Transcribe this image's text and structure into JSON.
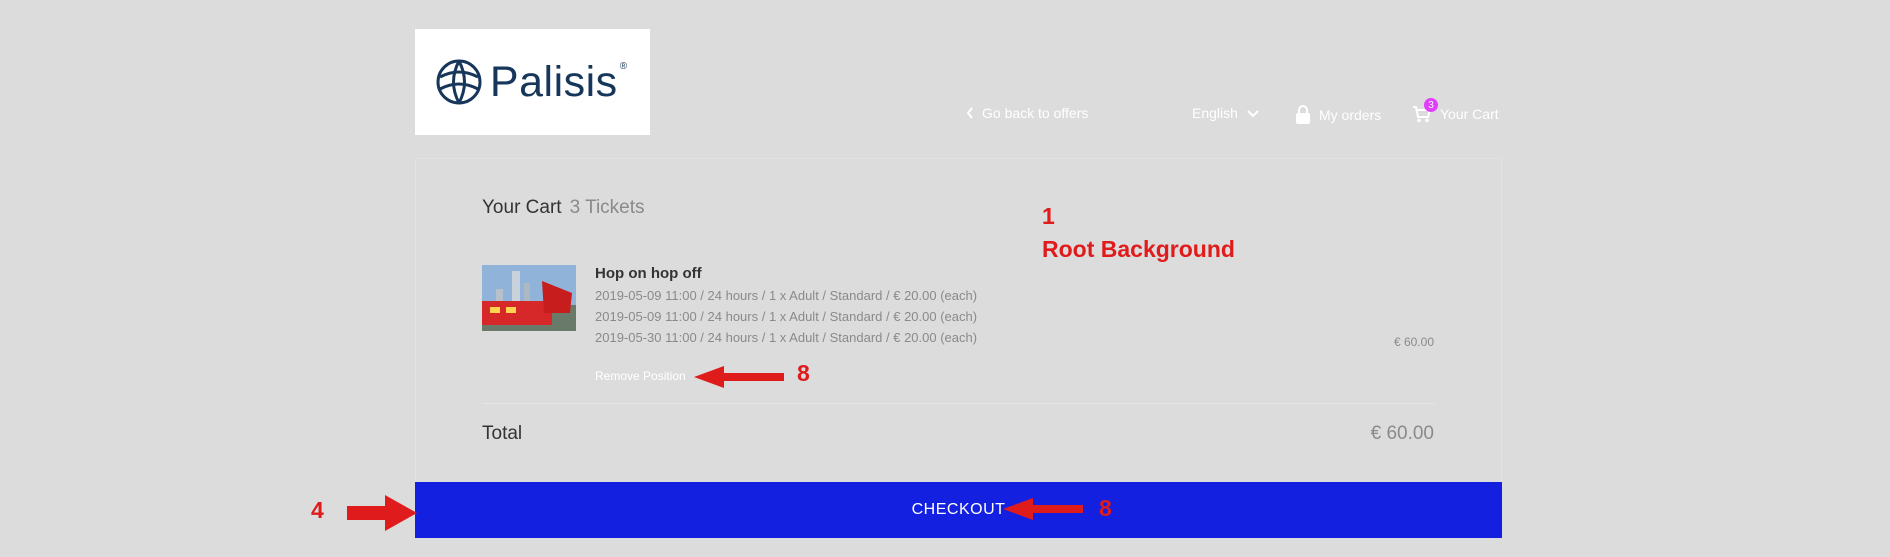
{
  "logo": {
    "text": "Palisis",
    "reg": "®"
  },
  "nav": {
    "back": "Go back to offers",
    "language": "English",
    "orders": "My orders",
    "cart": "Your Cart",
    "cart_badge": "3"
  },
  "cart": {
    "title": "Your Cart",
    "count": "3 Tickets",
    "product": {
      "name": "Hop on hop off",
      "lines": [
        "2019-05-09 11:00 / 24 hours / 1 x Adult / Standard / € 20.00 (each)",
        "2019-05-09 11:00 / 24 hours / 1 x Adult / Standard / € 20.00 (each)",
        "2019-05-30 11:00 / 24 hours / 1 x Adult / Standard / € 20.00 (each)"
      ],
      "remove": "Remove Position",
      "price": "€ 60.00"
    },
    "total_label": "Total",
    "total_value": "€ 60.00",
    "checkout": "CHECKOUT"
  },
  "annotations": {
    "a1_num": "1",
    "a1_text": "Root Background",
    "a8_remove": "8",
    "a8_checkout": "8",
    "a4": "4"
  },
  "colors": {
    "annotation": "#e01b1b",
    "checkout": "#1420e0",
    "badge": "#e040fb",
    "background": "#dcdcdc"
  }
}
